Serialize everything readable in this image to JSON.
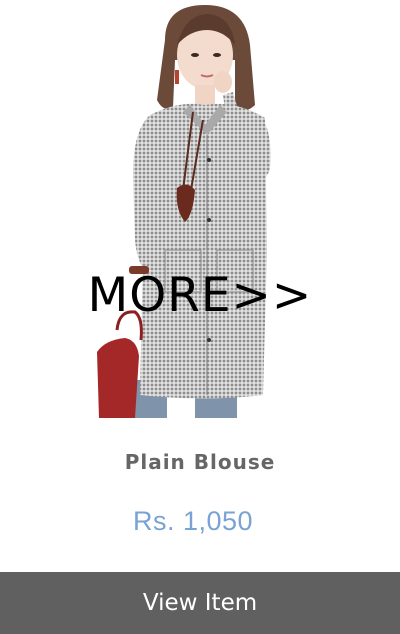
{
  "product": {
    "image_alt": "Woman wearing a plain gingham check long-sleeve blouse",
    "overlay_label": "MORE>>",
    "name": "Plain Blouse",
    "price": "Rs. 1,050",
    "cta_label": "View Item",
    "colors": {
      "price": "#7aa2d4",
      "button_bg": "#606060",
      "button_text": "#ffffff",
      "name": "#666666"
    }
  }
}
